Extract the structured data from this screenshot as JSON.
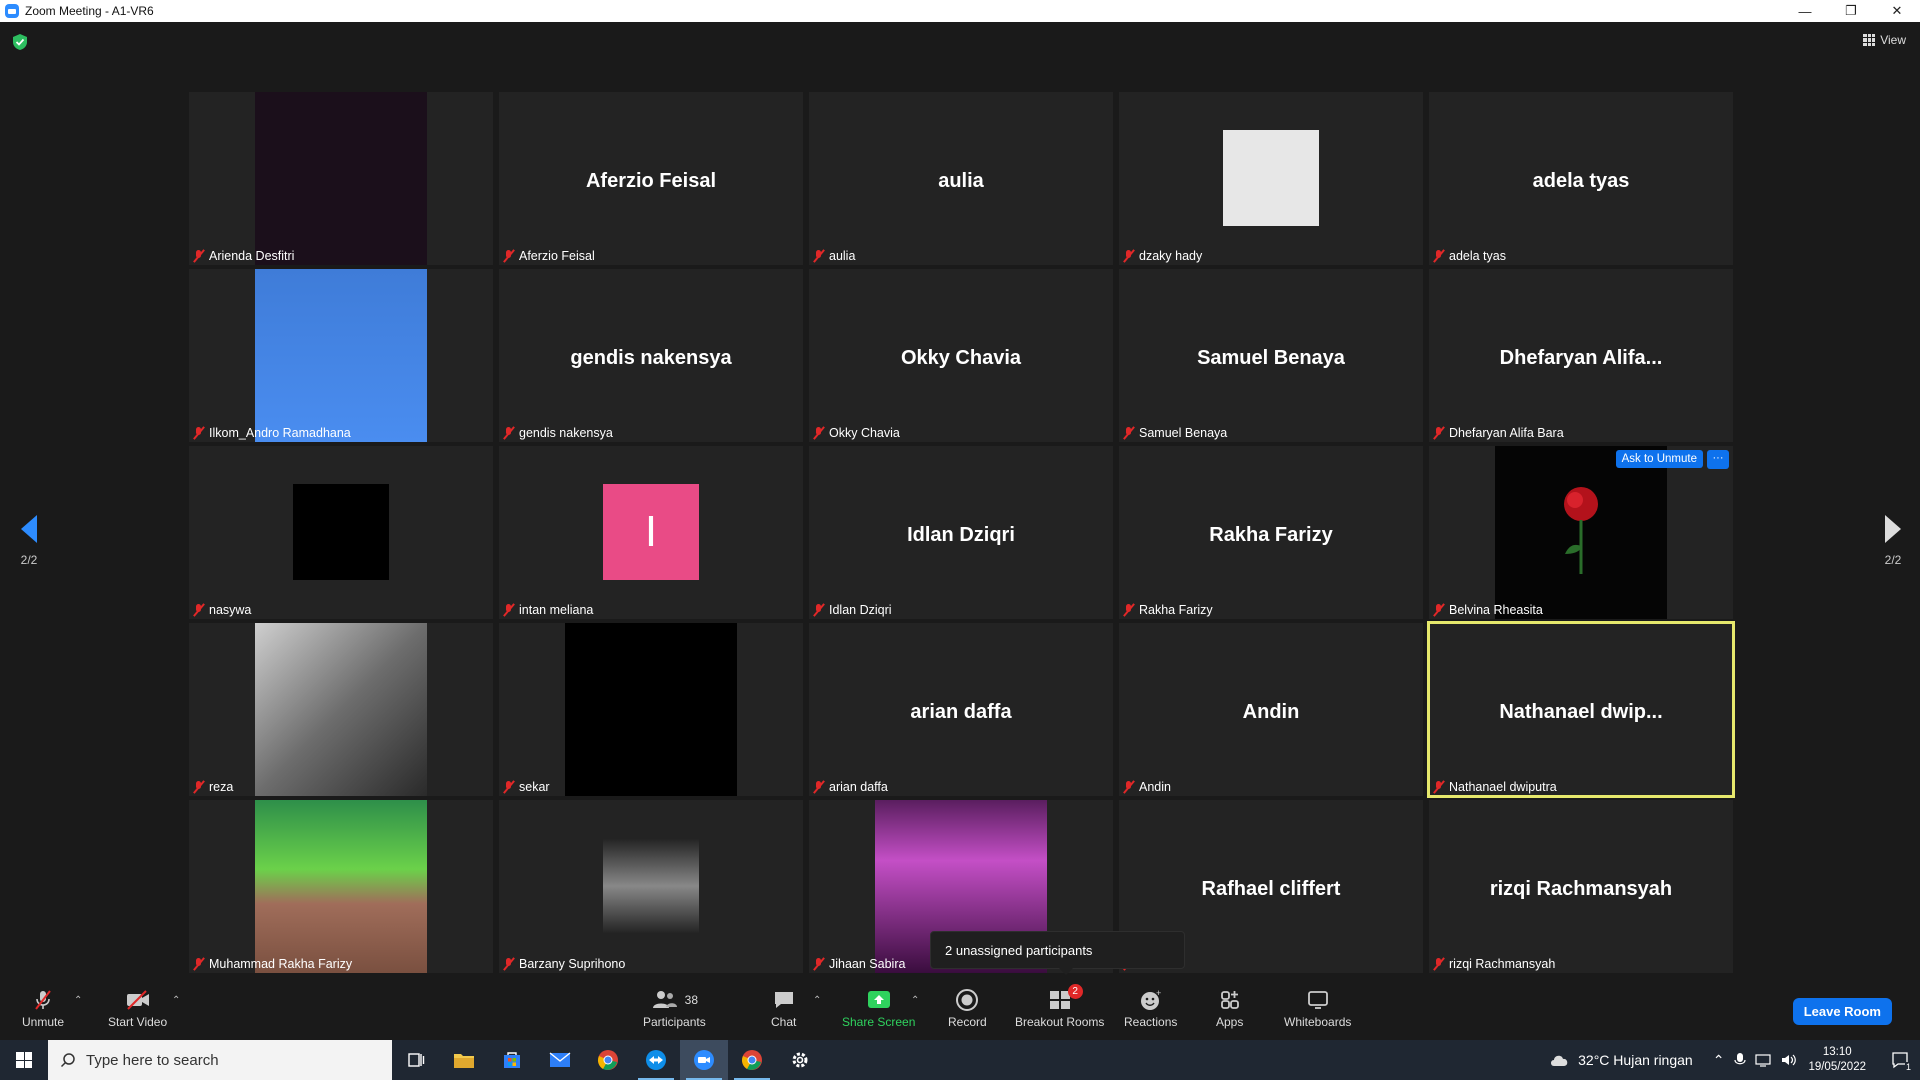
{
  "window": {
    "title": "Zoom Meeting - A1-VR6",
    "minimize": "—",
    "restore": "❐",
    "close": "✕"
  },
  "meeting": {
    "view_label": "View",
    "page_left": "2/2",
    "page_right": "2/2"
  },
  "tiles": [
    {
      "name": "Arienda Desfitri",
      "big": "",
      "thumb": "dark"
    },
    {
      "name": "Aferzio Feisal",
      "big": "Aferzio Feisal",
      "thumb": ""
    },
    {
      "name": "aulia",
      "big": "aulia",
      "thumb": ""
    },
    {
      "name": "dzaky hady",
      "big": "",
      "thumb": "badge"
    },
    {
      "name": "adela tyas",
      "big": "adela tyas",
      "thumb": ""
    },
    {
      "name": "Ilkom_Andro Ramadhana",
      "big": "",
      "thumb": "sky"
    },
    {
      "name": "gendis nakensya",
      "big": "gendis nakensya",
      "thumb": ""
    },
    {
      "name": "Okky Chavia",
      "big": "Okky Chavia",
      "thumb": ""
    },
    {
      "name": "Samuel Benaya",
      "big": "Samuel Benaya",
      "thumb": ""
    },
    {
      "name": "Dhefaryan Alifa Bara",
      "big": "Dhefaryan  Alifa...",
      "thumb": ""
    },
    {
      "name": "nasywa",
      "big": "",
      "thumb": "black-small"
    },
    {
      "name": "intan meliana",
      "big": "",
      "thumb": "pink",
      "initial": "I"
    },
    {
      "name": "Idlan Dziqri",
      "big": "Idlan Dziqri",
      "thumb": ""
    },
    {
      "name": "Rakha Farizy",
      "big": "Rakha Farizy",
      "thumb": ""
    },
    {
      "name": "Belvina Rheasita",
      "big": "",
      "thumb": "rose",
      "ask_unmute": "Ask to Unmute",
      "more": "···"
    },
    {
      "name": "reza",
      "big": "",
      "thumb": "bw"
    },
    {
      "name": "sekar",
      "big": "",
      "thumb": "black"
    },
    {
      "name": "arian daffa",
      "big": "arian daffa",
      "thumb": ""
    },
    {
      "name": "Andin",
      "big": "Andin",
      "thumb": ""
    },
    {
      "name": "Nathanael dwiputra",
      "big": "Nathanael  dwip...",
      "thumb": "",
      "active": true
    },
    {
      "name": "Muhammad Rakha Farizy",
      "big": "",
      "thumb": "green"
    },
    {
      "name": "Barzany Suprihono",
      "big": "",
      "thumb": "singer"
    },
    {
      "name": "Jihaan Sabira",
      "big": "",
      "thumb": "club"
    },
    {
      "name": "cliffert",
      "big": "Rafhael cliffert",
      "thumb": ""
    },
    {
      "name": "rizqi Rachmansyah",
      "big": "rizqi Rachmansyah",
      "thumb": ""
    }
  ],
  "popup": {
    "text": "2 unassigned participants"
  },
  "toolbar": {
    "unmute": "Unmute",
    "start_video": "Start Video",
    "participants": "Participants",
    "participants_count": "38",
    "chat": "Chat",
    "share_screen": "Share Screen",
    "record": "Record",
    "breakout_rooms": "Breakout Rooms",
    "breakout_badge": "2",
    "reactions": "Reactions",
    "apps": "Apps",
    "whiteboards": "Whiteboards",
    "leave_room": "Leave Room",
    "share_color": "#2fd25e"
  },
  "taskbar": {
    "search_placeholder": "Type here to search",
    "weather": "32°C  Hujan ringan",
    "time": "13:10",
    "date": "19/05/2022",
    "notification_count": "1"
  }
}
